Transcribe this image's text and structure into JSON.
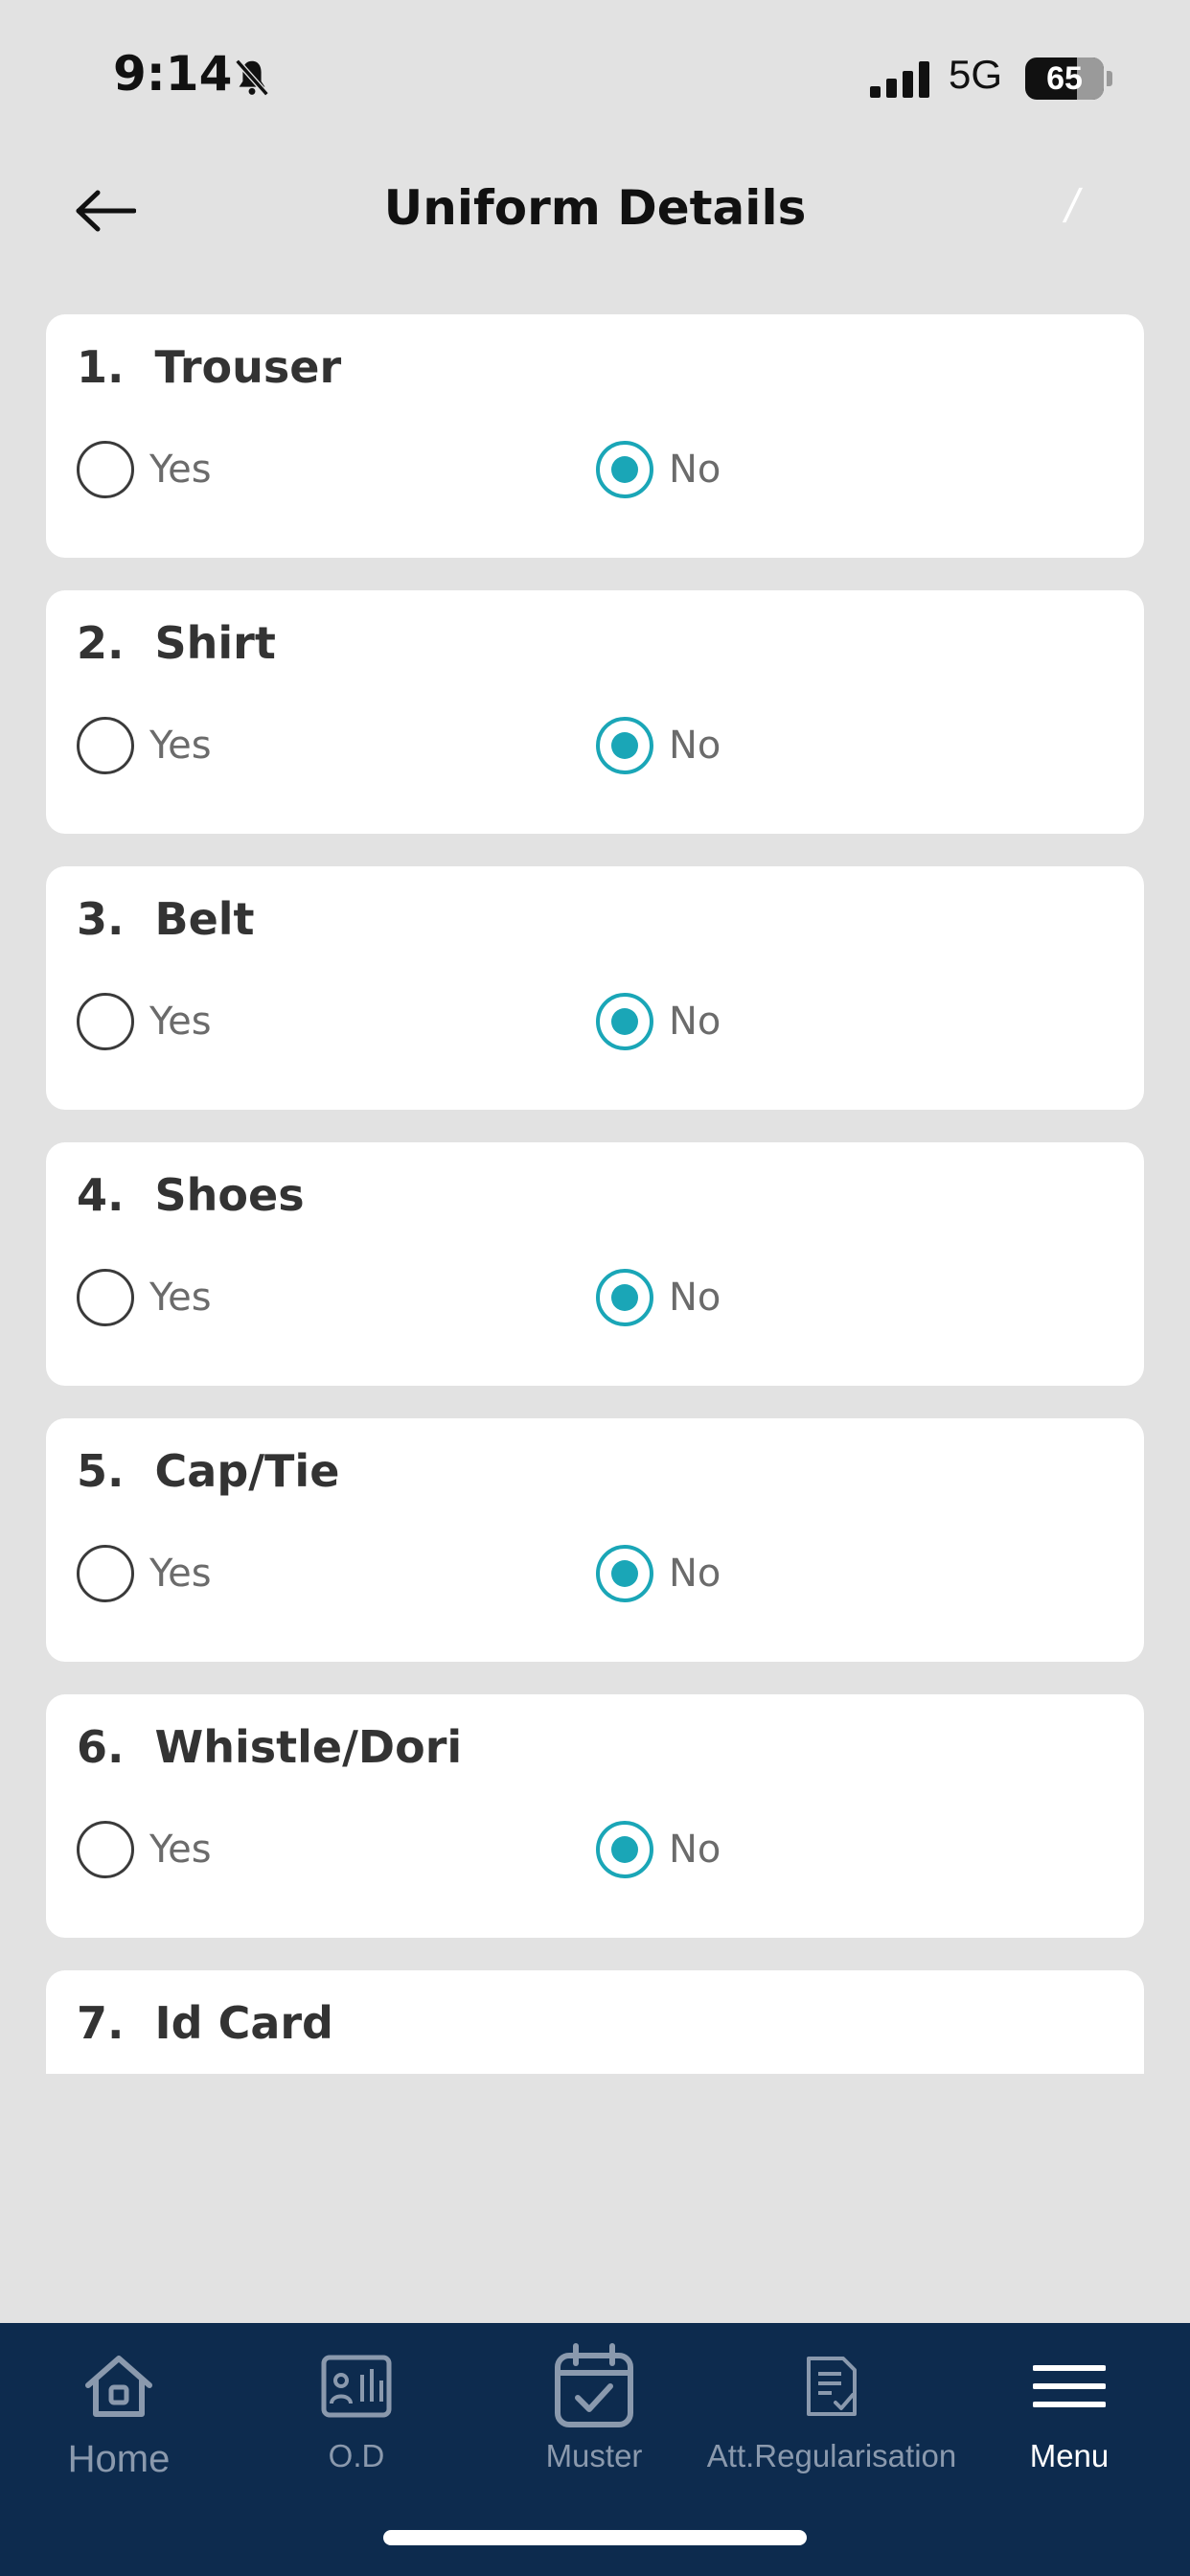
{
  "status_bar": {
    "time": "9:14",
    "network": "5G",
    "battery": "65"
  },
  "header": {
    "title": "Uniform Details",
    "edit_mark": "/"
  },
  "questions": [
    {
      "number": "1.",
      "label": "Trouser",
      "yes_label": "Yes",
      "no_label": "No",
      "selected": "No"
    },
    {
      "number": "2.",
      "label": "Shirt",
      "yes_label": "Yes",
      "no_label": "No",
      "selected": "No"
    },
    {
      "number": "3.",
      "label": "Belt",
      "yes_label": "Yes",
      "no_label": "No",
      "selected": "No"
    },
    {
      "number": "4.",
      "label": "Shoes",
      "yes_label": "Yes",
      "no_label": "No",
      "selected": "No"
    },
    {
      "number": "5.",
      "label": "Cap/Tie",
      "yes_label": "Yes",
      "no_label": "No",
      "selected": "No"
    },
    {
      "number": "6.",
      "label": "Whistle/Dori",
      "yes_label": "Yes",
      "no_label": "No",
      "selected": "No"
    },
    {
      "number": "7.",
      "label": "Id Card"
    }
  ],
  "bottom_nav": {
    "items": [
      {
        "label": "Home",
        "icon": "home-icon"
      },
      {
        "label": "O.D",
        "icon": "od-icon"
      },
      {
        "label": "Muster",
        "icon": "calendar-check-icon"
      },
      {
        "label": "Att.Regularisation",
        "icon": "document-check-icon"
      },
      {
        "label": "Menu",
        "icon": "hamburger-icon",
        "active": true
      }
    ]
  },
  "colors": {
    "accent": "#1aa6b7",
    "nav_background": "#0d2b4e",
    "page_background": "#e2e2e2"
  }
}
